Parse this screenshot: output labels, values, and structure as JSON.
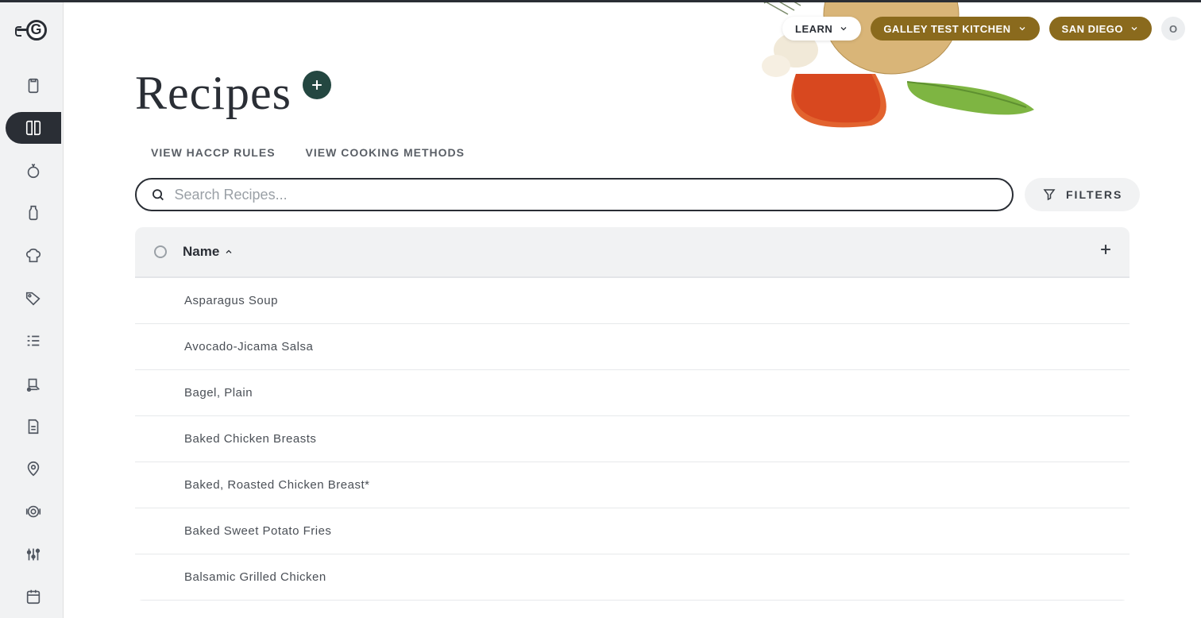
{
  "header": {
    "learn": "LEARN",
    "kitchen": "GALLEY TEST KITCHEN",
    "location": "SAN DIEGO",
    "avatar_initial": "O"
  },
  "page": {
    "title": "Recipes",
    "sublinks": {
      "haccp": "VIEW HACCP RULES",
      "cooking": "VIEW COOKING METHODS"
    },
    "search_placeholder": "Search Recipes...",
    "filters_label": "FILTERS"
  },
  "table": {
    "col_name": "Name",
    "rows": [
      "Asparagus Soup",
      "Avocado-Jicama Salsa",
      "Bagel, Plain",
      "Baked Chicken Breasts",
      "Baked, Roasted Chicken Breast*",
      "Baked Sweet Potato Fries",
      "Balsamic Grilled Chicken"
    ]
  },
  "sidebar": {
    "items": [
      {
        "id": "clipboard"
      },
      {
        "id": "recipes"
      },
      {
        "id": "ingredient"
      },
      {
        "id": "container"
      },
      {
        "id": "chef"
      },
      {
        "id": "tag"
      },
      {
        "id": "list"
      },
      {
        "id": "delivery"
      },
      {
        "id": "document"
      },
      {
        "id": "location"
      },
      {
        "id": "menu"
      },
      {
        "id": "settings"
      },
      {
        "id": "calendar"
      }
    ]
  }
}
